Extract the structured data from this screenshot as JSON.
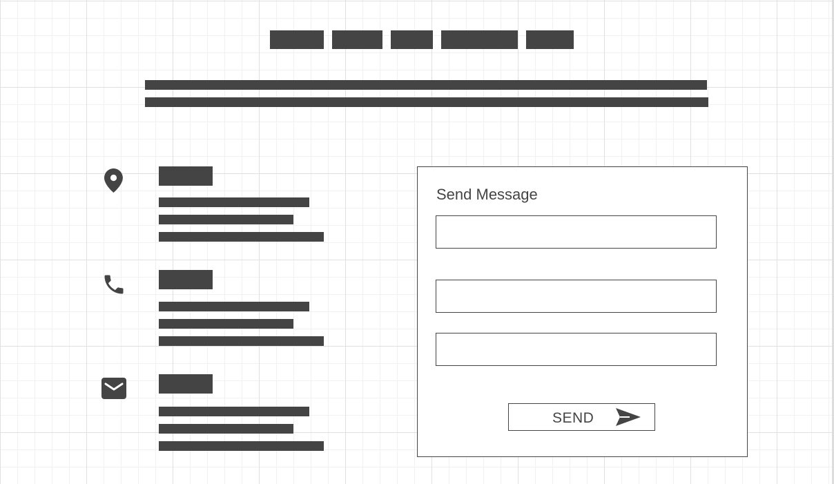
{
  "theme": {
    "placeholder_color": "#444444",
    "background": "#ffffff",
    "grid_major": "#e0e0e0",
    "grid_minor": "#f1f1f1"
  },
  "nav": {
    "items": [
      "nav-placeholder-1",
      "nav-placeholder-2",
      "nav-placeholder-3",
      "nav-placeholder-4",
      "nav-placeholder-5"
    ]
  },
  "contact_info": {
    "blocks": [
      {
        "icon": "location-pin-icon"
      },
      {
        "icon": "phone-icon"
      },
      {
        "icon": "envelope-icon"
      }
    ]
  },
  "form": {
    "title": "Send Message",
    "fields": [
      {
        "value": ""
      },
      {
        "value": ""
      },
      {
        "value": ""
      }
    ],
    "send_label": "SEND",
    "send_icon": "paper-plane-icon"
  }
}
